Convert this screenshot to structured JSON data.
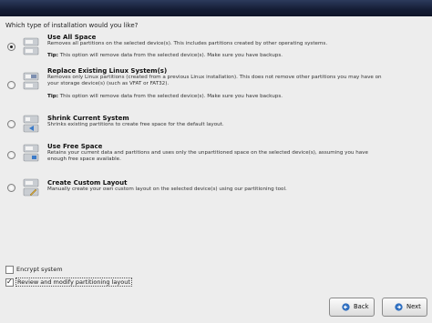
{
  "prompt": "Which type of installation would you like?",
  "options": [
    {
      "title": "Use All Space",
      "desc": "Removes all partitions on the selected device(s).  This includes partitions created by other operating systems.",
      "tip_label": "Tip:",
      "tip_text": " This option will remove data from the selected device(s).  Make sure you have backups.",
      "selected": true,
      "icon": "disk-all-space-icon"
    },
    {
      "title": "Replace Existing Linux System(s)",
      "desc": "Removes only Linux partitions (created from a previous Linux installation).  This does not remove other partitions you may have on your storage device(s) (such as VFAT or FAT32).",
      "tip_label": "Tip:",
      "tip_text": " This option will remove data from the selected device(s).  Make sure you have backups.",
      "selected": false,
      "icon": "disk-replace-icon"
    },
    {
      "title": "Shrink Current System",
      "desc": "Shrinks existing partitions to create free space for the default layout.",
      "selected": false,
      "icon": "disk-shrink-icon"
    },
    {
      "title": "Use Free Space",
      "desc": "Retains your current data and partitions and uses only the unpartitioned space on the selected device(s), assuming you have enough free space available.",
      "selected": false,
      "icon": "disk-free-space-icon"
    },
    {
      "title": "Create Custom Layout",
      "desc": "Manually create your own custom layout on the selected device(s) using our partitioning tool.",
      "selected": false,
      "icon": "disk-custom-icon"
    }
  ],
  "checks": {
    "encrypt_label": "Encrypt system",
    "encrypt_checked": false,
    "review_label": "Review and modify partitioning layout",
    "review_checked": true
  },
  "buttons": {
    "back_label": "Back",
    "next_label": "Next"
  },
  "colors": {
    "banner": "#141c34",
    "background": "#ededed"
  }
}
